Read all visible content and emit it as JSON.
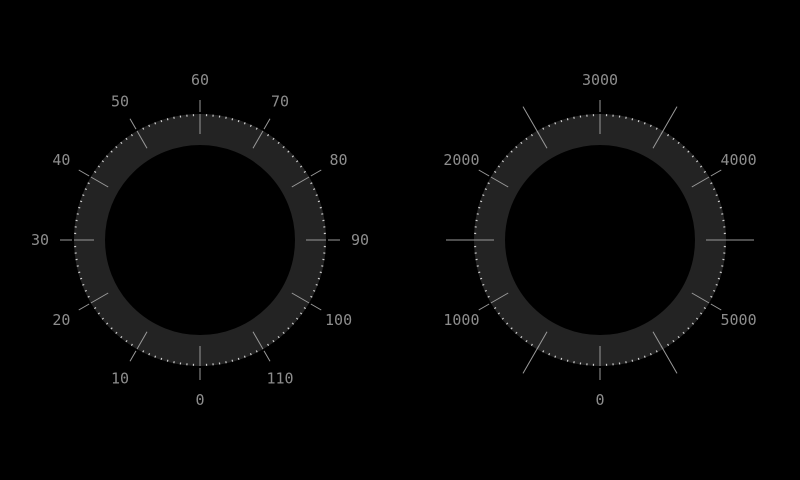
{
  "colors": {
    "background": "#000000",
    "ring": "#232323",
    "tick_major": "#9a9a9a",
    "tick_minor": "#cfcfcf",
    "label": "#8d8d8d"
  },
  "dials": [
    {
      "name": "left-dial",
      "labels": [
        "0",
        "10",
        "20",
        "30",
        "40",
        "50",
        "60",
        "70",
        "80",
        "90",
        "100",
        "110"
      ],
      "major_tick_count": 12,
      "minor_dots_per_segment": 9,
      "outward_ticks_at_labels": true,
      "extended_cardinal_ticks": false
    },
    {
      "name": "right-dial",
      "labels": [
        "0",
        "1000",
        "2000",
        "3000",
        "4000",
        "5000"
      ],
      "major_tick_count": 12,
      "minor_dots_per_segment": 9,
      "outward_ticks_at_labels": true,
      "extended_cardinal_ticks": true
    }
  ]
}
